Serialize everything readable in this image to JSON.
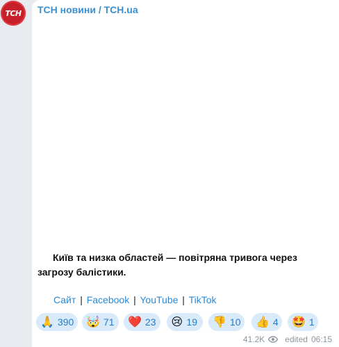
{
  "channel": {
    "name": "ТСН новини / TCH.ua",
    "avatar_text": "ТСН"
  },
  "message": {
    "text": "Київ та низка областей — повітряна тривога через загрозу балістики.",
    "links": [
      {
        "label": "Сайт"
      },
      {
        "label": "Facebook"
      },
      {
        "label": "YouTube"
      },
      {
        "label": "TikTok"
      }
    ],
    "separator": "|"
  },
  "reactions": [
    {
      "emoji": "🙏",
      "icon": "praying-hands-icon",
      "count": "390"
    },
    {
      "emoji": "🤯",
      "icon": "exploding-head-icon",
      "count": "71"
    },
    {
      "emoji": "❤️",
      "icon": "red-heart-icon",
      "count": "23"
    },
    {
      "emoji": "😢",
      "icon": "crying-face-icon",
      "count": "19"
    },
    {
      "emoji": "👎",
      "icon": "thumbs-down-icon",
      "count": "10"
    },
    {
      "emoji": "👍",
      "icon": "thumbs-up-icon",
      "count": "4"
    },
    {
      "emoji": "🤩",
      "icon": "star-struck-icon",
      "count": "1"
    }
  ],
  "meta": {
    "views": "41.2K",
    "edited_label": "edited",
    "time": "06:15"
  },
  "colors": {
    "background": "#e7ebf0",
    "bubble": "#ffffff",
    "accent": "#3a8fcf",
    "link": "#2a8ad6",
    "reaction_bg": "#d9ebfb",
    "avatar": "#c8202b"
  }
}
